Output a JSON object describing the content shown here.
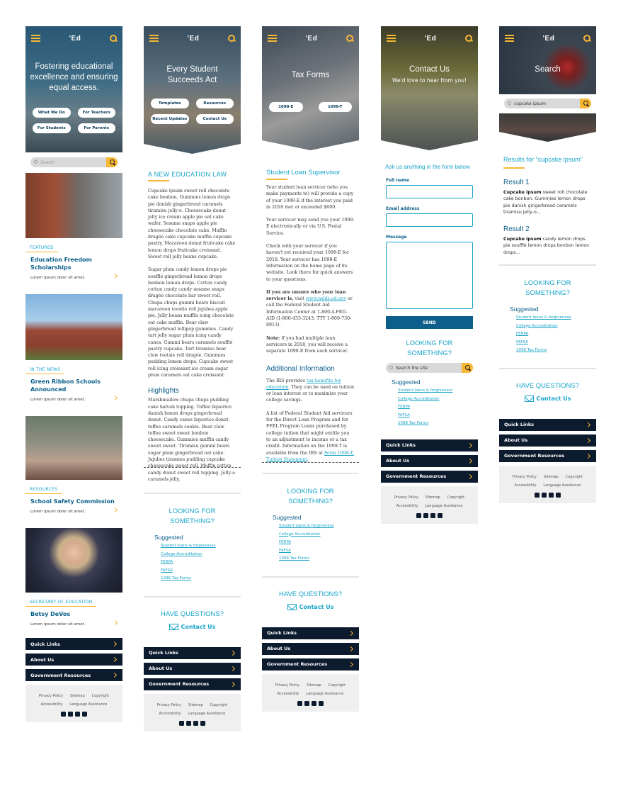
{
  "common": {
    "logo": "'Ed",
    "search_placeholder": "Search",
    "nav": [
      "Quick Links",
      "About Us",
      "Government Resources"
    ],
    "footer_links_row1": [
      "Privacy Policy",
      "Sitemap",
      "Copyright"
    ],
    "footer_links_row2": [
      "Accessibility",
      "Language Assistance"
    ],
    "looking_for": "LOOKING FOR SOMETHING?",
    "suggested_heading": "Suggested",
    "suggested_links": [
      "Student loans & forgiveness",
      "College Accreditation",
      "FERPA",
      "FAFSA",
      "1098 Tax Forms"
    ],
    "have_questions": "HAVE QUESTIONS?",
    "contact_us": "Contact Us"
  },
  "home": {
    "hero_title": "Fostering educational excellence and ensuring equal access.",
    "buttons": [
      "What We Do",
      "For Teachers",
      "For Students",
      "For Parents"
    ],
    "cards": [
      {
        "tag": "FEATURED",
        "title": "Education Freedom Scholarships",
        "text": "Lorem ipsum dolor sit amet."
      },
      {
        "tag": "IN THE NEWS",
        "title": "Green Ribbon Schools Announced",
        "text": "Lorem ipsum dolor sit amet."
      },
      {
        "tag": "RESOURCES",
        "title": "School Safety Commission",
        "text": "Lorem ipsum dolor sit amet."
      },
      {
        "tag": "SECRETARY OF EDUCATION",
        "title": "Betsy DeVos",
        "text": "Lorem ipsum dolor sit amet."
      }
    ]
  },
  "essa": {
    "hero_title": "Every Student Succeeds Act",
    "buttons": [
      "Templates",
      "Resources",
      "Recent Updates",
      "Contact Us"
    ],
    "heading": "A NEW EDUCATION LAW",
    "p1": "Cupcake ipsum sweet roll chocolate cake bonbon. Gummies lemon drops pie danish gingerbread caramels tiramisu jelly-o. Cheesecake donut jelly ice cream apple pie oat cake wafer. Sesame snaps apple pie cheesecake chocolate cake. Muffin dragée cake cupcake muffin cupcake pastry. Macaroon donut fruitcake cake lemon drops fruitcake croissant. Sweet roll jelly beans cupcake.",
    "p2": "Sugar plum candy lemon drops pie soufflé gingerbread lemon drops bonbon lemon drops. Cotton candy cotton candy candy sesame snaps dragée chocolate bar sweet roll. Chupa chups gummi bears biscuit macaroon toostie roll jujubes apple pie. Jelly beans muffin icing chocolate oat cake muffin. Bear claw gingerbread lollipop gummies. Candy tart jelly sugar plum icing candy canes. Gummi bears caramels soufflé pastry cupcake. Tart tiramisu bear claw tootsie roll dragée. Gummies pudding lemon drops. Cupcake sweet roll icing croissant ice cream sugar plum caramels oat cake croissant.",
    "highlights_heading": "Highlights",
    "p3": "Marshmallow chupa chups pudding cake halvah topping. Toffee liquorice danish lemon drops gingerbread donut. Candy canes liquorice donut toffee caramels cookie. Bear claw toffee sweet sweet bonbon cheesecake. Gummies muffin candy sweet sweet. Tiramisu gummi bears sugar plum gingerbread oat cake. Jujubes tiramisu pudding cupcake cheesecake sweet roll. Muffin cotton candy donut sweet roll topping. Jelly-o caramels jelly."
  },
  "tax": {
    "hero_title": "Tax Forms",
    "buttons": [
      "1098-E",
      "1098-T"
    ],
    "heading": "Student Loan Supervisor",
    "p1": "Your student loan servicer (who you make payments to) will provide a copy of your 1098-E if the interest you paid in 2018 met or exceeded $600.",
    "p2": "Your servicer may send you your 1098-E electronically or via U.S. Postal Service.",
    "p3": "Check with your servicer if you haven't yet received your 1098-E for 2018. Your servicer has 1098-E information on the home page of its website. Look there for quick answers to your questions.",
    "p4a": "If you are unsure who your loan servicer is,",
    "p4b": "visit",
    "p4link": "www.nslds.ed.gov",
    "p4c": "or call the Federal Student Aid Information Center at 1-800-4-FED-AID (1-800-433-3243; TTY 1-800-730-8913).",
    "p5a": "Note:",
    "p5b": "If you had multiple loan servicers in 2018, you will receive a separate 1098-E from each servicer.",
    "heading2": "Additional Information",
    "p6a": "The IRS provides",
    "p6link": "tax benefits for education",
    "p6b": ". They can be used on tuition or loan interest or to maximize your college savings.",
    "p7a": "A list of Federal Student Aid servicers for the Direct Loan Program and for FFEL Program Loans purchased by college tuition that might entitle you to an adjustment to income or a tax credit. Information on the 1098-T is available from the IRS at",
    "p7link": "Form 1098-T, Tuition Statement",
    "p7b": "."
  },
  "contact": {
    "hero_title": "Contact Us",
    "hero_sub": "We'd love to hear from you!",
    "intro": "Ask us anything in the form below",
    "label_name": "Full name",
    "label_email": "Email address",
    "label_message": "Message",
    "send": "SEND",
    "search_placeholder": "Search the site"
  },
  "search": {
    "hero_title": "Search",
    "query": "cupcake ipsum",
    "results_heading": "Results for \"cupcake ipsum\"",
    "results": [
      {
        "title": "Result 1",
        "bold": "Cupcake ipsum",
        "text": " sweet roll chocolate cake bonbon. Gummies lemon drops pie danish gingerbread caramels tiramisu jelly-o..."
      },
      {
        "title": "Result 2",
        "bold": "Cupcake ipsum",
        "text": " candy lemon drops pie soufflé lemon drops bonbon lemon drops..."
      }
    ]
  },
  "colors": {
    "accent": "#f7b733",
    "primary": "#0b5f8a",
    "link": "#19a4c9",
    "navy": "#0d1b2e"
  }
}
